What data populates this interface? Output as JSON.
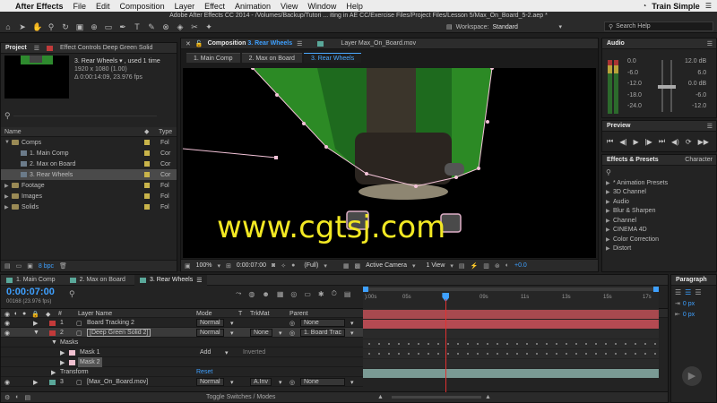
{
  "menubar": {
    "apple": "",
    "app": "After Effects",
    "items": [
      "File",
      "Edit",
      "Composition",
      "Layer",
      "Effect",
      "Animation",
      "View",
      "Window",
      "Help"
    ],
    "brand": "Train Simple"
  },
  "window_title": "Adobe After Effects CC 2014 - /Volumes/Backup/Tutori ... iting in AE CC/Exercise Files/Project Files/Lesson 5/Max_On_Board_5-2.aep *",
  "toolbar": {
    "workspace_label": "Workspace:",
    "workspace_value": "Standard",
    "search_placeholder": "Search Help"
  },
  "project": {
    "tab": "Project",
    "effect_tab": "Effect Controls Deep Green Solid",
    "info_name": "3. Rear Wheels ▾ , used 1 time",
    "info_size": "1920 x 1080 (1.00)",
    "info_duration": "Δ 0:00:14:09, 23.976 fps",
    "col_name": "Name",
    "col_type": "Type",
    "items": [
      {
        "name": "Comps",
        "type": "Fol",
        "indent": 0,
        "kind": "folder",
        "open": true
      },
      {
        "name": "1. Main Comp",
        "type": "Cor",
        "indent": 1,
        "kind": "comp"
      },
      {
        "name": "2. Max on Board",
        "type": "Cor",
        "indent": 1,
        "kind": "comp"
      },
      {
        "name": "3. Rear Wheels",
        "type": "Cor",
        "indent": 1,
        "kind": "comp",
        "selected": true
      },
      {
        "name": "Footage",
        "type": "Fol",
        "indent": 0,
        "kind": "folder"
      },
      {
        "name": "Images",
        "type": "Fol",
        "indent": 0,
        "kind": "folder"
      },
      {
        "name": "Solids",
        "type": "Fol",
        "indent": 0,
        "kind": "folder"
      }
    ],
    "bpc": "8 bpc"
  },
  "comp": {
    "tab_prefix": "Composition",
    "tab_name": "3. Rear Wheels",
    "layer_tab": "Layer Max_On_Board.mov",
    "subtabs": [
      "1. Main Comp",
      "2. Max on Board",
      "3. Rear Wheels"
    ],
    "active_subtab": 2,
    "watermark": "www.cgtsj.com",
    "footer": {
      "zoom": "100%",
      "timecode": "0:00:07:00",
      "resolution": "(Full)",
      "camera": "Active Camera",
      "view": "1 View",
      "exposure": "+0.0"
    }
  },
  "audio": {
    "tab": "Audio",
    "left_levels": [
      "0.0",
      "-6.0",
      "-12.0",
      "-18.0",
      "-24.0"
    ],
    "right_levels": [
      "12.0 dB",
      "6.0",
      "0.0 dB",
      "-6.0",
      "-12.0"
    ]
  },
  "preview": {
    "tab": "Preview"
  },
  "effects": {
    "tab": "Effects & Presets",
    "tab2": "Character",
    "items": [
      "* Animation Presets",
      "3D Channel",
      "Audio",
      "Blur & Sharpen",
      "Channel",
      "CINEMA 4D",
      "Color Correction",
      "Distort"
    ]
  },
  "timeline": {
    "tabs": [
      "1. Main Comp",
      "2. Max on Board",
      "3. Rear Wheels"
    ],
    "active_tab": 2,
    "timecode": "0:00:07:00",
    "frames": "00168 (23.976 fps)",
    "col_layer": "Layer Name",
    "col_mode": "Mode",
    "col_t": "T",
    "col_trkmat": "TrkMat",
    "col_parent": "Parent",
    "ruler": [
      "):00s",
      "05s",
      "09s",
      "11s",
      "13s",
      "15s",
      "17s"
    ],
    "playhead_fraction": 0.28,
    "layers": [
      {
        "num": "1",
        "name": "Board Tracking 2",
        "mode": "Normal",
        "trkmat": "",
        "parent": "None",
        "color": "#c23a3a"
      },
      {
        "num": "2",
        "name": "[Deep Green Solid 2]",
        "mode": "Normal",
        "trkmat": "None",
        "parent": "1. Board Trac",
        "color": "#c23a3a",
        "selected": true
      },
      {
        "num": "3",
        "name": "[Max_On_Board.mov]",
        "mode": "Normal",
        "trkmat": "A.Inv",
        "parent": "None",
        "color": "#5aa89a"
      }
    ],
    "masks_label": "Masks",
    "mask1": "Mask 1",
    "mask1_mode": "Add",
    "mask1_inverted": "Inverted",
    "mask2": "Mask 2",
    "transform_label": "Transform",
    "transform_reset": "Reset",
    "footer": "Toggle Switches / Modes"
  },
  "paragraph": {
    "tab": "Paragraph",
    "px1": "0 px",
    "px2": "0 px"
  }
}
